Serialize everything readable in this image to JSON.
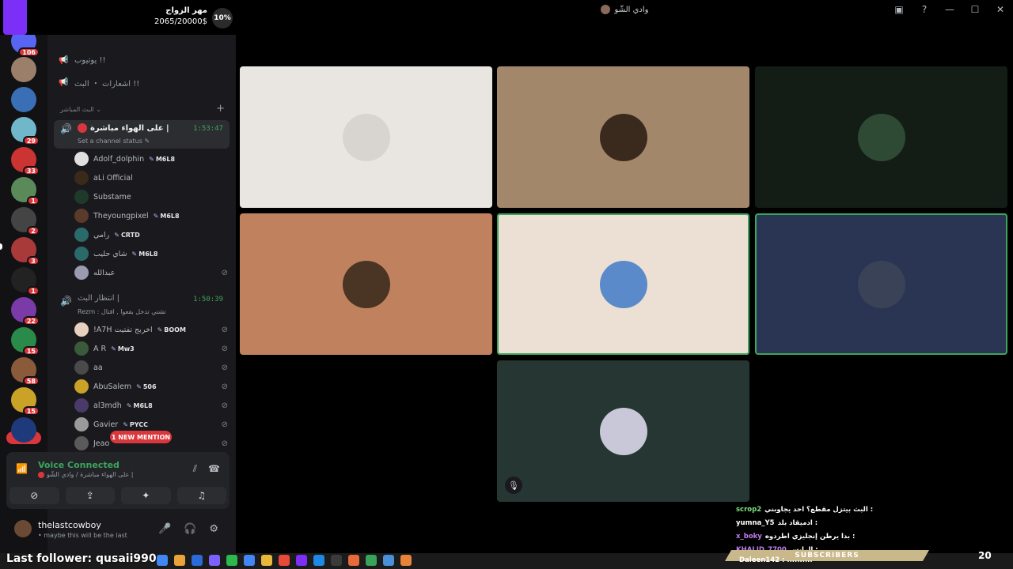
{
  "window": {
    "title": "وادي الشّو"
  },
  "goal": {
    "title": "مهر الزواج",
    "progress_text": "2065/20000$",
    "percent_label": "10%",
    "fraction": 0.1
  },
  "rail": {
    "top_badge": "106",
    "servers": [
      {
        "color": "#9b7f6a",
        "badge": ""
      },
      {
        "color": "#3a6fb5",
        "badge": ""
      },
      {
        "color": "#6fb7c9",
        "badge": "29"
      },
      {
        "color": "#cc3333",
        "badge": "33"
      },
      {
        "color": "#5a8a5a",
        "badge": "1"
      },
      {
        "color": "#444444",
        "badge": "2"
      },
      {
        "color": "#a83a3a",
        "badge": "3"
      },
      {
        "color": "#222222",
        "badge": "1"
      },
      {
        "color": "#7a3aa8",
        "badge": "22"
      },
      {
        "color": "#2a8a4a",
        "badge": "15"
      },
      {
        "color": "#8a5a3a",
        "badge": "58"
      },
      {
        "color": "#c9a227",
        "badge": "15"
      },
      {
        "color": "#1e3a7a",
        "badge": ""
      }
    ],
    "new_label": "NEW"
  },
  "sidebar": {
    "channels": [
      {
        "label": "يوتيوب !!",
        "icon": "megaphone-icon"
      },
      {
        "label": "اشعارات ・ البث !!",
        "icon": "megaphone-icon"
      }
    ],
    "category": "البث المباشر ⌄",
    "live_channel": {
      "name": "على الهواء مباشرة |",
      "timer": "1:53:47",
      "status": "Set a channel status ✎"
    },
    "live_members": [
      {
        "name": "Adolf_dolphin",
        "tag": "M6L8",
        "color": "#e0e0e0",
        "muted": false
      },
      {
        "name": "aLi Official",
        "tag": "",
        "color": "#3a2a1a",
        "muted": false
      },
      {
        "name": "Substame",
        "tag": "",
        "color": "#1e3a2a",
        "muted": false
      },
      {
        "name": "Theyoungpixel",
        "tag": "M6L8",
        "color": "#5a3a2a",
        "muted": false
      },
      {
        "name": "رامي",
        "tag": "CRTD",
        "color": "#2a6a6a",
        "muted": false
      },
      {
        "name": "شاي حليب",
        "tag": "M6L8",
        "color": "#2a6a6a",
        "muted": false
      },
      {
        "name": "عبدالله",
        "tag": "",
        "color": "#9a9ab0",
        "muted": true
      }
    ],
    "wait_channel": {
      "name": "انتظار البث |",
      "timer": "1:50:39",
      "status": "Rezm : تشتي تدخل بفعوا , اقتال"
    },
    "wait_members": [
      {
        "name": "!A7H اخربج تفتيت",
        "tag": "BOOM",
        "color": "#e8d0c0",
        "muted": true
      },
      {
        "name": "A R",
        "tag": "Mw3",
        "color": "#3a5a3a",
        "muted": true
      },
      {
        "name": "aa",
        "tag": "",
        "color": "#4a4a4a",
        "muted": true
      },
      {
        "name": "AbuSalem",
        "tag": "506",
        "color": "#c9a227",
        "muted": true
      },
      {
        "name": "al3mdh",
        "tag": "M6L8",
        "color": "#4a3a6a",
        "muted": true
      },
      {
        "name": "Gavier",
        "tag": "PYCC",
        "color": "#9a9a9a",
        "muted": true
      },
      {
        "name": "Jeao",
        "tag": "",
        "color": "#5a5a5a",
        "muted": true
      }
    ],
    "mention_label": "1 NEW MENTION"
  },
  "voice": {
    "title": "Voice Connected",
    "subtitle": "على الهواء مباشرة / وادي الشّو |"
  },
  "user": {
    "name": "thelastcowboy",
    "status": "• maybe this will be the last"
  },
  "tiles": [
    {
      "bg": "#e9e6e2",
      "face": "#d8d4cf",
      "speaking": false,
      "muted": false
    },
    {
      "bg": "#a3876a",
      "face": "#3a2a1e",
      "speaking": false,
      "muted": false
    },
    {
      "bg": "#141c16",
      "face": "#2e4a34",
      "speaking": false,
      "muted": false
    },
    {
      "bg": "#c0825e",
      "face": "#4a3424",
      "speaking": false,
      "muted": false
    },
    {
      "bg": "#ebe0d3",
      "face": "#5a8ac9",
      "speaking": true,
      "muted": false
    },
    {
      "bg": "#2a3553",
      "face": "#3a4258",
      "speaking": true,
      "muted": false
    },
    {
      "bg": "#263632",
      "face": "#c8c8d8",
      "speaking": false,
      "muted": true
    }
  ],
  "chat": [
    {
      "name": "scrop2",
      "name_color": "#7ee07e",
      "text": "البث بيتزل مقطع؟ احد يجاوبني :"
    },
    {
      "name": "yumna_Y5",
      "name_color": "#ffffff",
      "text": "ادميقاد بلد :"
    },
    {
      "name": "x_boky",
      "name_color": "#c07ef0",
      "text": "بدا يرطن إنجليزي اطردوه :"
    },
    {
      "name": "KHALID_7700",
      "name_color": "#c07ef0",
      "text": "الرابس :"
    }
  ],
  "chat_bottom": "Daleen142 : ..........",
  "subs_label": "SUBSCRIBERS",
  "subs_count": "20",
  "follower": "Last follower: qusaii990",
  "taskbar_icons": [
    "#4285f4",
    "#e8a33a",
    "#2a6ad9",
    "#7b61ff",
    "#2db84d",
    "#4285f4",
    "#e8b83a",
    "#e84a3a",
    "#7b2ff7",
    "#1e88e5",
    "#3a3a3a",
    "#e86a3a",
    "#3aa35a",
    "#4a90d9",
    "#e8833a"
  ]
}
